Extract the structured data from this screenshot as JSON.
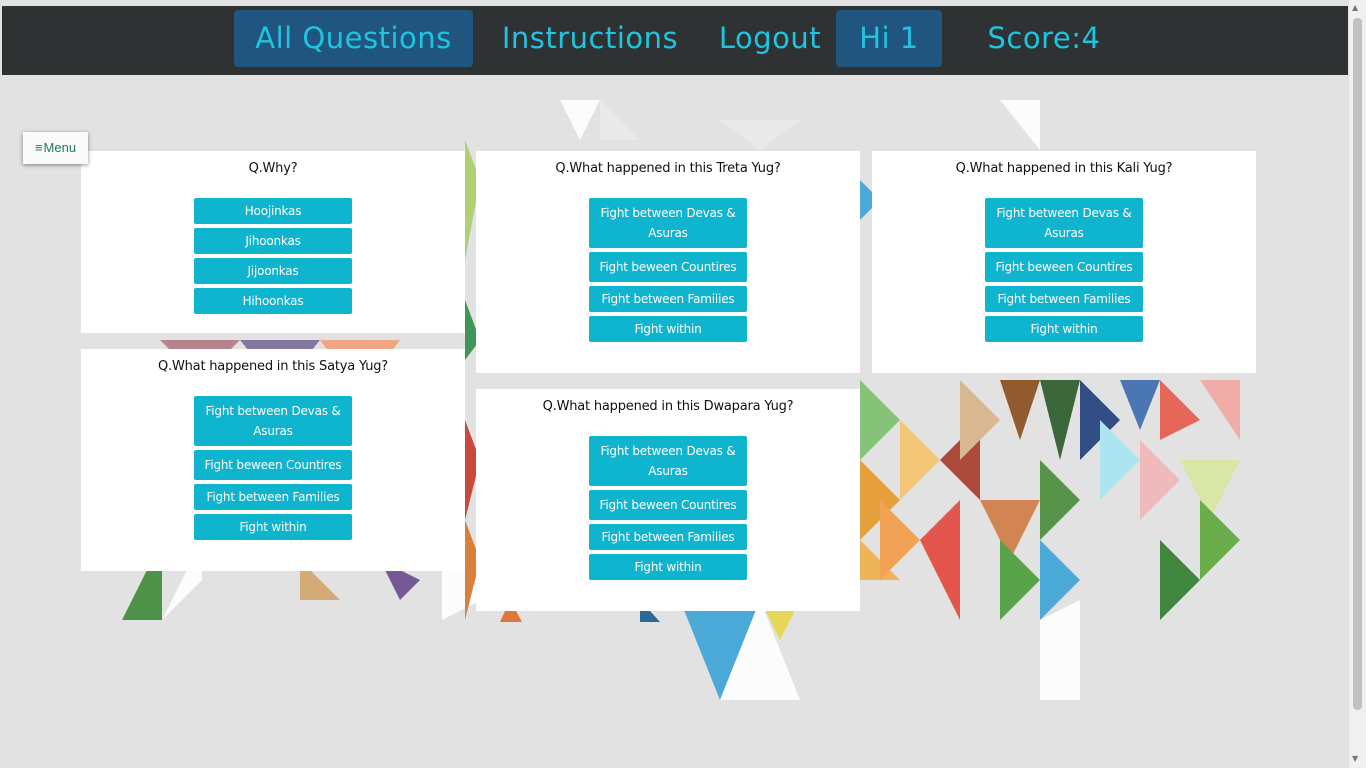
{
  "nav": {
    "all_questions": "All Questions",
    "instructions": "Instructions",
    "logout": "Logout",
    "greeting": "Hi 1",
    "score": "Score:4"
  },
  "menu": {
    "label": "Menu",
    "icon": "hamburger-icon"
  },
  "colors": {
    "topbar": "#2e3233",
    "nav_text": "#1fc4e0",
    "nav_active": "#20557f",
    "option_bg": "#0fb4cf",
    "card_bg": "#ffffff"
  },
  "questions": [
    {
      "title": "Q.Why?",
      "options": [
        "Hoojinkas",
        "Jihoonkas",
        "Jijoonkas",
        "Hihoonkas"
      ]
    },
    {
      "title": "Q.What happened in this Treta Yug?",
      "options": [
        "Fight between Devas & Asuras",
        "Fight beween Countires",
        "Fight between Families",
        "Fight within"
      ]
    },
    {
      "title": "Q.What happened in this Kali Yug?",
      "options": [
        "Fight between Devas & Asuras",
        "Fight beween Countires",
        "Fight between Families",
        "Fight within"
      ]
    },
    {
      "title": "Q.What happened in this Satya Yug?",
      "options": [
        "Fight between Devas & Asuras",
        "Fight beween Countires",
        "Fight between Families",
        "Fight within"
      ]
    },
    {
      "title": "Q.What happened in this Dwapara Yug?",
      "options": [
        "Fight between Devas & Asuras",
        "Fight beween Countires",
        "Fight between Families",
        "Fight within"
      ]
    }
  ]
}
